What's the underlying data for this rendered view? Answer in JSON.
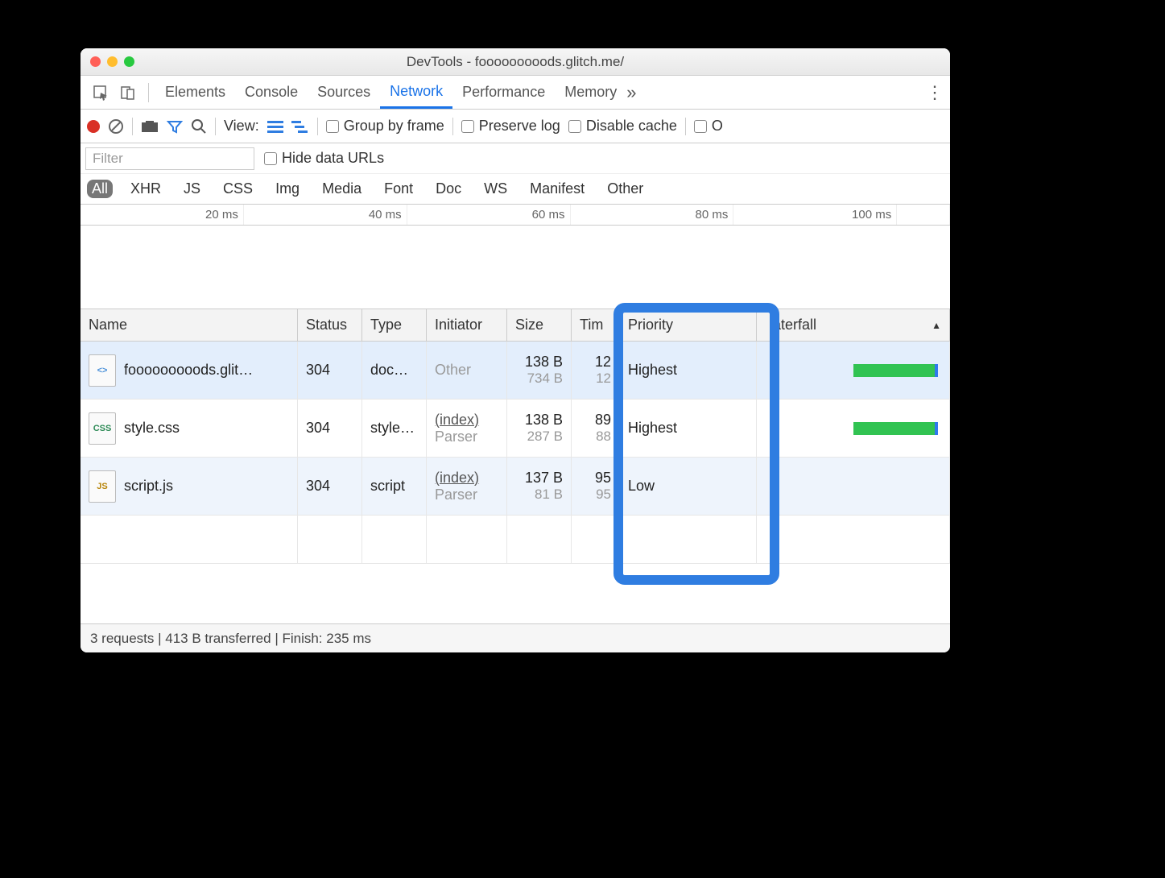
{
  "window": {
    "title": "DevTools - fooooooooods.glitch.me/"
  },
  "tabs": {
    "items": [
      "Elements",
      "Console",
      "Sources",
      "Network",
      "Performance",
      "Memory"
    ],
    "activeIndex": 3,
    "overflow": "»"
  },
  "toolbar": {
    "viewLabel": "View:",
    "groupByFrame": "Group by frame",
    "preserveLog": "Preserve log",
    "disableCache": "Disable cache",
    "offlineTruncated": "O"
  },
  "filter": {
    "placeholder": "Filter",
    "hideDataUrls": "Hide data URLs"
  },
  "types": [
    "All",
    "XHR",
    "JS",
    "CSS",
    "Img",
    "Media",
    "Font",
    "Doc",
    "WS",
    "Manifest",
    "Other"
  ],
  "timeline": {
    "ticks": [
      "20 ms",
      "40 ms",
      "60 ms",
      "80 ms",
      "100 ms"
    ]
  },
  "columns": {
    "name": "Name",
    "status": "Status",
    "type": "Type",
    "initiator": "Initiator",
    "size": "Size",
    "time": "Time",
    "priority": "Priority",
    "waterfall": "Waterfall"
  },
  "columnsTruncated": {
    "time": "Tim",
    "waterfall": "aterfall"
  },
  "rows": [
    {
      "name": "fooooooooods.glit…",
      "iconKind": "html",
      "iconText": "<>",
      "status": "304",
      "type": "doc…",
      "initiator": "Other",
      "initiatorSub": "",
      "size": "138 B",
      "sizeSub": "734 B",
      "time": "12",
      "timeSub": "12",
      "priority": "Highest",
      "bar": true
    },
    {
      "name": "style.css",
      "iconKind": "css",
      "iconText": "CSS",
      "status": "304",
      "type": "style…",
      "initiator": "(index)",
      "initiatorSub": "Parser",
      "size": "138 B",
      "sizeSub": "287 B",
      "time": "89",
      "timeSub": "88",
      "priority": "Highest",
      "bar": true
    },
    {
      "name": "script.js",
      "iconKind": "js",
      "iconText": "JS",
      "status": "304",
      "type": "script",
      "initiator": "(index)",
      "initiatorSub": "Parser",
      "size": "137 B",
      "sizeSub": "81 B",
      "time": "95",
      "timeSub": "95",
      "priority": "Low",
      "bar": false
    }
  ],
  "statusbar": {
    "text": "3 requests | 413 B transferred | Finish: 235 ms"
  }
}
